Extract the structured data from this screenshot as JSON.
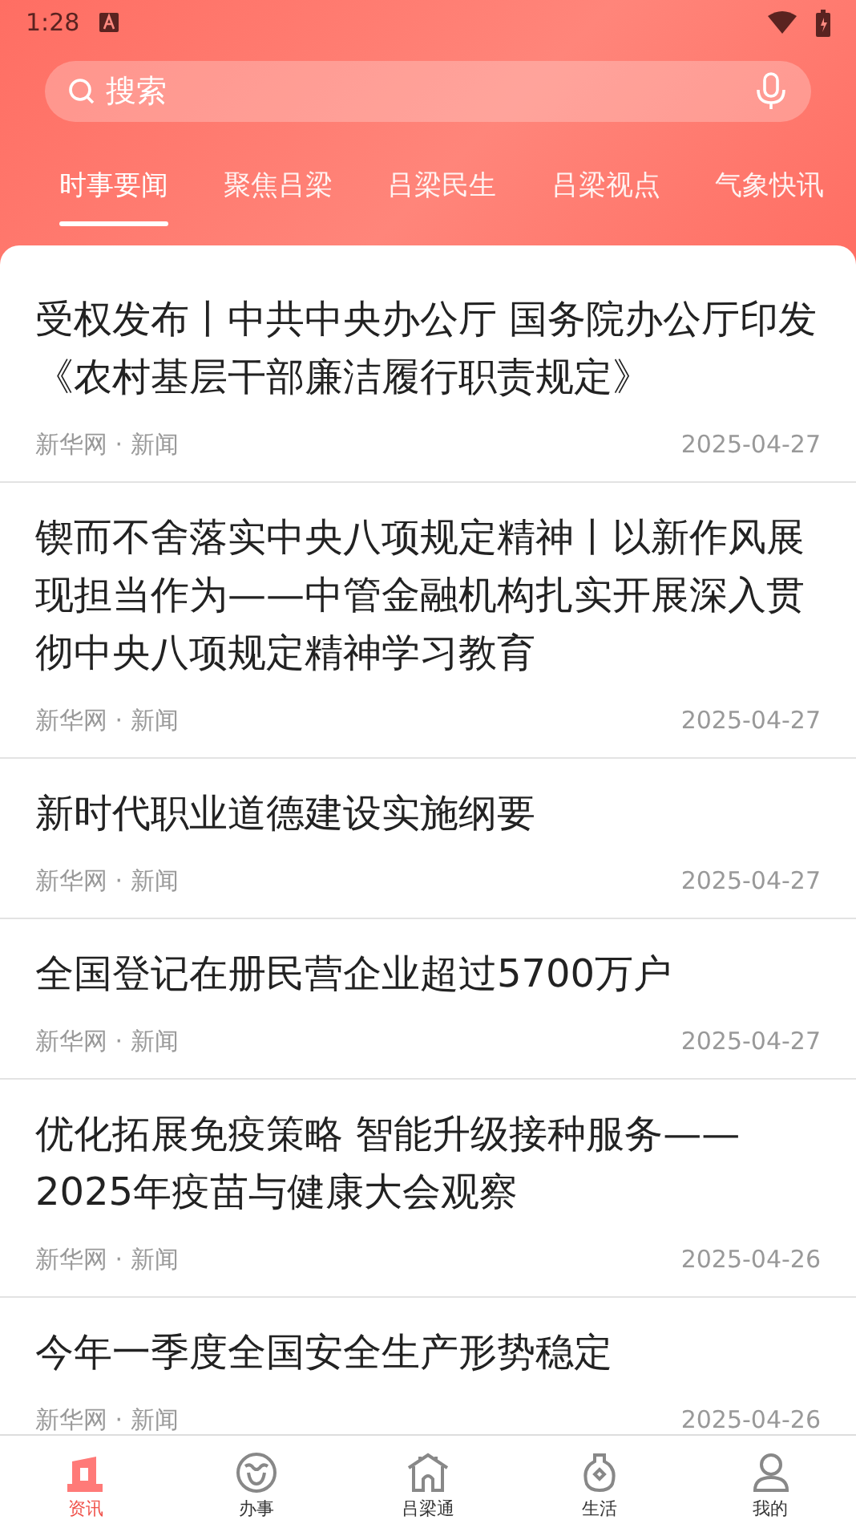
{
  "status_bar": {
    "time": "1:28"
  },
  "search": {
    "placeholder": "搜索"
  },
  "tabs": [
    {
      "label": "时事要闻",
      "selected": true
    },
    {
      "label": "聚焦吕梁",
      "selected": false
    },
    {
      "label": "吕梁民生",
      "selected": false
    },
    {
      "label": "吕梁视点",
      "selected": false
    },
    {
      "label": "气象快讯",
      "selected": false
    }
  ],
  "articles": [
    {
      "title": "受权发布丨中共中央办公厅 国务院办公厅印发《农村基层干部廉洁履行职责规定》",
      "source": "新华网 · 新闻",
      "date": "2025-04-27"
    },
    {
      "title": "锲而不舍落实中央八项规定精神丨以新作风展现担当作为——中管金融机构扎实开展深入贯彻中央八项规定精神学习教育",
      "source": "新华网 · 新闻",
      "date": "2025-04-27"
    },
    {
      "title": "新时代职业道德建设实施纲要",
      "source": "新华网 · 新闻",
      "date": "2025-04-27"
    },
    {
      "title": "全国登记在册民营企业超过5700万户",
      "source": "新华网 · 新闻",
      "date": "2025-04-27"
    },
    {
      "title": "优化拓展免疫策略 智能升级接种服务——2025年疫苗与健康大会观察",
      "source": "新华网 · 新闻",
      "date": "2025-04-26"
    },
    {
      "title": "今年一季度全国安全生产形势稳定",
      "source": "新华网 · 新闻",
      "date": "2025-04-26"
    }
  ],
  "bottom_nav": [
    {
      "label": "资讯",
      "kind": "news",
      "selected": true
    },
    {
      "label": "办事",
      "kind": "service",
      "selected": false
    },
    {
      "label": "吕梁通",
      "kind": "city",
      "selected": false
    },
    {
      "label": "生活",
      "kind": "life",
      "selected": false
    },
    {
      "label": "我的",
      "kind": "profile",
      "selected": false
    }
  ]
}
